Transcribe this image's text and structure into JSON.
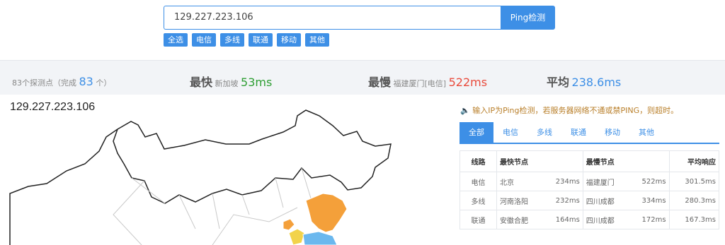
{
  "search": {
    "value": "129.227.223.106",
    "button": "Ping检测"
  },
  "filters": [
    "全选",
    "电信",
    "多线",
    "联通",
    "移动",
    "其他"
  ],
  "stats": {
    "probes_text": "83个探测点（完成",
    "completed": "83",
    "probes_suffix": "个）",
    "fastest_label": "最快",
    "fastest_node": "新加坡",
    "fastest_value": "53ms",
    "slowest_label": "最慢",
    "slowest_node": "福建厦门[电信]",
    "slowest_value": "522ms",
    "avg_label": "平均",
    "avg_value": "238.6ms"
  },
  "map_title": "129.227.223.106",
  "notice": "输入IP为Ping检测，若服务器网络不通或禁PING，则超时。",
  "tabs": [
    "全部",
    "电信",
    "多线",
    "联通",
    "移动",
    "其他"
  ],
  "table": {
    "headers": {
      "line": "线路",
      "fast": "最快节点",
      "slow": "最慢节点",
      "avg": "平均响应"
    },
    "rows": [
      {
        "line": "电信",
        "fast_node": "北京",
        "fast_ms": "234ms",
        "slow_node": "福建厦门",
        "slow_ms": "522ms",
        "avg": "301.5ms"
      },
      {
        "line": "多线",
        "fast_node": "河南洛阳",
        "fast_ms": "232ms",
        "slow_node": "四川成都",
        "slow_ms": "334ms",
        "avg": "280.3ms"
      },
      {
        "line": "联通",
        "fast_node": "安徽合肥",
        "fast_ms": "164ms",
        "slow_node": "四川成都",
        "slow_ms": "172ms",
        "avg": "167.3ms"
      }
    ]
  },
  "colors": {
    "accent": "#3d8fe6",
    "green": "#2e9e33",
    "red": "#e94b3c",
    "orange": "#f4a03a",
    "notice": "#b97f2a"
  }
}
